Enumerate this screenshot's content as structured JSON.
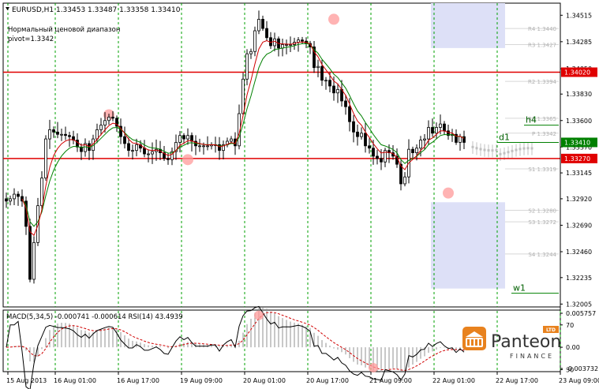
{
  "header": {
    "symbol_line": "EURUSD,H1  1.33453 1.33487 1.33358 1.33410",
    "range_title": "Нормальный ценовой диапазон",
    "pivot_text": "pivot=1.3342"
  },
  "colors": {
    "candle": "#000000",
    "fast_ma": "#d00000",
    "slow_ma": "#008000",
    "support_resistance": "#e00000",
    "grid": "#00a000",
    "highlight": "#ff9999",
    "zone": "#dde0f7",
    "ghost": "#c0c0c0",
    "price_label": "#008000",
    "level_label": "#e00000"
  },
  "chart_data": {
    "type": "candlestick",
    "price_axis": {
      "ylim": [
        1.3198,
        1.3462
      ],
      "ticks": [
        "1.34515",
        "1.34285",
        "1.34050",
        "1.33830",
        "1.33600",
        "1.33370",
        "1.33145",
        "1.32920",
        "1.32690",
        "1.32460",
        "1.32235",
        "1.32005"
      ]
    },
    "time_labels": [
      {
        "label": "15 Aug 2013",
        "index": 0
      },
      {
        "label": "16 Aug 01:00",
        "index": 12
      },
      {
        "label": "16 Aug 17:00",
        "index": 28
      },
      {
        "label": "19 Aug 09:00",
        "index": 44
      },
      {
        "label": "20 Aug 01:00",
        "index": 60
      },
      {
        "label": "20 Aug 17:00",
        "index": 76
      },
      {
        "label": "21 Aug 09:00",
        "index": 92
      },
      {
        "label": "22 Aug 01:00",
        "index": 108
      },
      {
        "label": "22 Aug 17:00",
        "index": 124
      },
      {
        "label": "23 Aug 09:00",
        "index": 140
      }
    ],
    "close": [
      1.329,
      1.3292,
      1.3296,
      1.3294,
      1.329,
      1.3268,
      1.3222,
      1.3254,
      1.3286,
      1.331,
      1.3344,
      1.3352,
      1.335,
      1.3348,
      1.3348,
      1.3347,
      1.3346,
      1.3343,
      1.3337,
      1.3333,
      1.334,
      1.3334,
      1.3344,
      1.3352,
      1.3356,
      1.336,
      1.3363,
      1.3362,
      1.3355,
      1.3346,
      1.334,
      1.3334,
      1.3334,
      1.3339,
      1.3336,
      1.3331,
      1.3331,
      1.3333,
      1.3335,
      1.3332,
      1.3327,
      1.3326,
      1.3333,
      1.3341,
      1.3347,
      1.3344,
      1.3347,
      1.3342,
      1.3338,
      1.3338,
      1.3338,
      1.3338,
      1.3339,
      1.3339,
      1.3334,
      1.3339,
      1.3342,
      1.3344,
      1.3338,
      1.3366,
      1.3396,
      1.3418,
      1.342,
      1.3438,
      1.3448,
      1.344,
      1.3432,
      1.3425,
      1.3431,
      1.3423,
      1.3426,
      1.3426,
      1.3426,
      1.3428,
      1.343,
      1.3429,
      1.3427,
      1.3424,
      1.3406,
      1.3407,
      1.3395,
      1.3395,
      1.339,
      1.3384,
      1.3387,
      1.3377,
      1.3372,
      1.3359,
      1.335,
      1.3346,
      1.3349,
      1.3338,
      1.3336,
      1.3329,
      1.3327,
      1.3324,
      1.3334,
      1.3332,
      1.3329,
      1.3322,
      1.3305,
      1.3311,
      1.3335,
      1.3332,
      1.3336,
      1.3343,
      1.3344,
      1.3354,
      1.3349,
      1.3354,
      1.3357,
      1.3351,
      1.3347,
      1.3348,
      1.3341,
      1.3346,
      1.3341
    ],
    "highlights": [
      {
        "index": 26,
        "price": 1.3365
      },
      {
        "index": 46,
        "price": 1.3326
      },
      {
        "index": 83,
        "price": 1.3448
      },
      {
        "index": 112,
        "price": 1.3297
      }
    ],
    "horizontal_levels": [
      {
        "label": "1.34020",
        "price": 1.3402
      },
      {
        "label": "1.33270",
        "price": 1.3327
      }
    ],
    "current_price": {
      "label": "1.33410",
      "price": 1.3341
    },
    "pivot_labels": [
      {
        "label": "R4 1.3440",
        "price": 1.344
      },
      {
        "label": "R3 1.3427",
        "price": 1.3426
      },
      {
        "label": "R2 1.3394",
        "price": 1.3394
      },
      {
        "label": "R1 1.3365",
        "price": 1.3362
      },
      {
        "label": "P 1.3342",
        "price": 1.3349
      },
      {
        "label": "S1 1.3319",
        "price": 1.3318
      },
      {
        "label": "S2 1.3280",
        "price": 1.3282
      },
      {
        "label": "S3 1.3272",
        "price": 1.3272
      },
      {
        "label": "S4 1.3244",
        "price": 1.3244
      }
    ],
    "timeframe_labels": [
      {
        "label": "h4",
        "price": 1.3358
      },
      {
        "label": "d1",
        "price": 1.3343
      },
      {
        "label": "w1",
        "price": 1.3212
      }
    ]
  },
  "macd_panel": {
    "header": "MACD(5,34,5) -0.000741 -0.000614  RSI(14) 43.4939",
    "ylim": [
      -0.0037,
      0.0057
    ],
    "ticks": [
      "0.005757",
      "70",
      "0.00",
      "30",
      "-0.003732"
    ]
  },
  "logo": {
    "name": "Panteon",
    "sub": "FINANCE",
    "badge": "LTD"
  }
}
